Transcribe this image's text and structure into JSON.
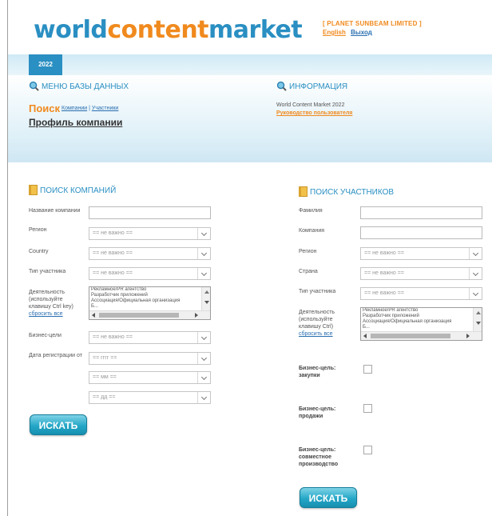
{
  "header": {
    "logo": {
      "part1": "world",
      "part2": "content",
      "part3": "market"
    },
    "company_name": "[ PLANET SUNBEAM LIMITED ]",
    "lang_link": "English",
    "logout_link": "Выход"
  },
  "nav": {
    "year_tab": "2022"
  },
  "db_menu": {
    "title": "МЕНЮ БАЗЫ ДАННЫХ",
    "search_label": "Поиск",
    "companies_link": "Компании",
    "separator": "|",
    "participants_link": "Участники",
    "profile_link": "Профиль компании"
  },
  "info": {
    "title": "ИНФОРМАЦИЯ",
    "event_text": "World Content Market 2022",
    "guide_link": "Руководство пользователя"
  },
  "company_search": {
    "title": "ПОИСК КОМПАНИЙ",
    "name_label": "Название компании",
    "name_value": "",
    "region_label": "Регион",
    "region_value": "== не важно ==",
    "country_label": "Country",
    "country_value": "== не важно ==",
    "type_label": "Тип участника",
    "type_value": "== не важно ==",
    "activity_label": "Деятельность (используйте клавишу Ctrl key)",
    "reset_link": "сбросить все",
    "activity_options": [
      "Рекламное/PR агентство",
      "Разработчик приложений",
      "Ассоциация/Официальная организация",
      "Б..."
    ],
    "goals_label": "Бизнес-цели",
    "goals_value": "== не важно ==",
    "reg_date_label": "Дата регистрации от",
    "year_value": "== гггг ==",
    "month_value": "== мм ==",
    "day_value": "== дд ==",
    "search_button": "ИСКАТЬ"
  },
  "participant_search": {
    "title": "ПОИСК УЧАСТНИКОВ",
    "surname_label": "Фамилия",
    "surname_value": "",
    "company_label": "Компания",
    "company_value": "",
    "region_label": "Регион",
    "region_value": "== не важно ==",
    "country_label": "Страна",
    "country_value": "== не важно ==",
    "type_label": "Тип участника",
    "type_value": "== не важно ==",
    "activity_label": "Деятельность (используйте клавишу Ctrl)",
    "reset_link": "сбросить все",
    "activity_options": [
      "Рекламное/PR агентство",
      "Разработчик приложений",
      "Ассоциация/Официальная организация",
      "Б..."
    ],
    "goal_purchases_label": "Бизнес-цель: закупки",
    "goal_sales_label": "Бизнес-цель: продажи",
    "goal_coproduction_label": "Бизнес-цель: совместное производство",
    "search_button": "ИСКАТЬ"
  },
  "colors": {
    "brand_blue": "#2a8fc2",
    "brand_orange": "#f08a1e",
    "button": "#25a7c7"
  },
  "icons": {
    "section_icon": "magnifier-icon",
    "form_icon": "notebook-icon"
  }
}
